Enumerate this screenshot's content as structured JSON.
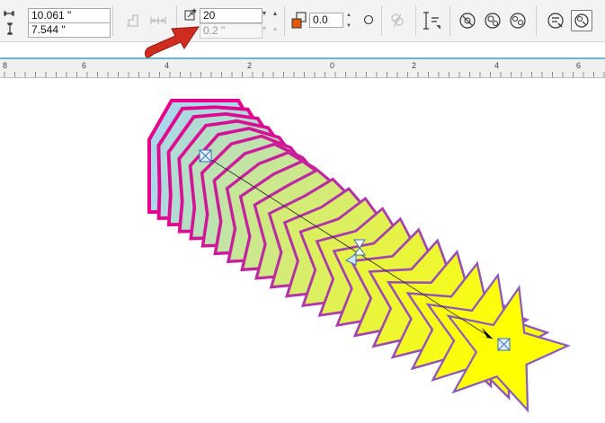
{
  "toolbar": {
    "width_value": "10.061 \"",
    "height_value": "7.544 \"",
    "steps_value": "20",
    "spacing_value": "0.2 \"",
    "rotation_value": "0.0"
  },
  "ruler": {
    "labels": [
      "8",
      "6",
      "4",
      "2",
      "0",
      "2",
      "4",
      "6"
    ]
  },
  "blend": {
    "start_shape": "square",
    "end_shape": "star",
    "start_fill": "#a8d8ea",
    "end_fill": "#ffff00",
    "start_outline": "#e8008a",
    "end_outline": "#8a5bc0",
    "steps": 20
  },
  "colors": {
    "arrow": "#d02b1f",
    "ruler_accent": "#66b7c9"
  },
  "icons": [
    "width-icon",
    "height-icon",
    "steps-icon",
    "spacing-icon",
    "rotation-icon",
    "pick-path-icon",
    "blend-direction-icon",
    "loop-blend-icon",
    "object-color-blend-icon",
    "start-end-icon",
    "path-properties-icon",
    "more-blend-options-icon"
  ]
}
